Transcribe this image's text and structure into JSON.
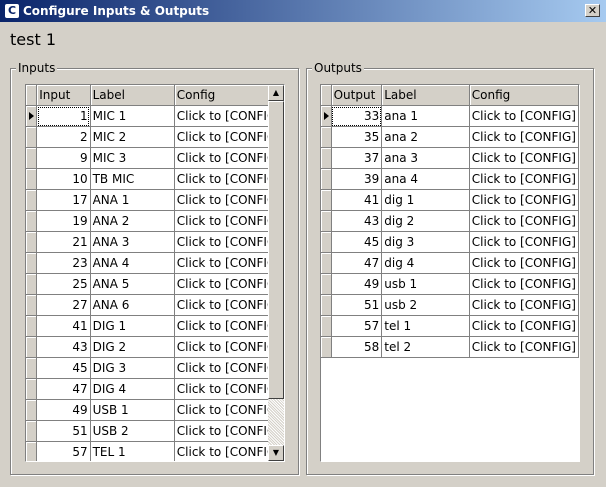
{
  "window": {
    "title": "Configure Inputs & Outputs",
    "app_icon": "C",
    "close": "✕"
  },
  "heading": "test 1",
  "inputs": {
    "group_label": "Inputs",
    "columns": [
      "Input",
      "Label",
      "Config"
    ],
    "rows": [
      {
        "num": "1",
        "label": "MIC 1",
        "config": "Click to [CONFIG]"
      },
      {
        "num": "2",
        "label": "MIC 2",
        "config": "Click to [CONFIG]"
      },
      {
        "num": "9",
        "label": "MIC 3",
        "config": "Click to [CONFIG]"
      },
      {
        "num": "10",
        "label": "TB MIC",
        "config": "Click to [CONFIG]"
      },
      {
        "num": "17",
        "label": "ANA 1",
        "config": "Click to [CONFIG]"
      },
      {
        "num": "19",
        "label": "ANA 2",
        "config": "Click to [CONFIG]"
      },
      {
        "num": "21",
        "label": "ANA 3",
        "config": "Click to [CONFIG]"
      },
      {
        "num": "23",
        "label": "ANA 4",
        "config": "Click to [CONFIG]"
      },
      {
        "num": "25",
        "label": "ANA 5",
        "config": "Click to [CONFIG]"
      },
      {
        "num": "27",
        "label": "ANA 6",
        "config": "Click to [CONFIG]"
      },
      {
        "num": "41",
        "label": "DIG 1",
        "config": "Click to [CONFIG]"
      },
      {
        "num": "43",
        "label": "DIG 2",
        "config": "Click to [CONFIG]"
      },
      {
        "num": "45",
        "label": "DIG 3",
        "config": "Click to [CONFIG]"
      },
      {
        "num": "47",
        "label": "DIG 4",
        "config": "Click to [CONFIG]"
      },
      {
        "num": "49",
        "label": "USB 1",
        "config": "Click to [CONFIG]"
      },
      {
        "num": "51",
        "label": "USB 2",
        "config": "Click to [CONFIG]"
      },
      {
        "num": "57",
        "label": "TEL 1",
        "config": "Click to [CONFIG]"
      }
    ],
    "scroll_up": "▲",
    "scroll_down": "▼"
  },
  "outputs": {
    "group_label": "Outputs",
    "columns": [
      "Output",
      "Label",
      "Config"
    ],
    "rows": [
      {
        "num": "33",
        "label": "ana 1",
        "config": "Click to [CONFIG]"
      },
      {
        "num": "35",
        "label": "ana 2",
        "config": "Click to [CONFIG]"
      },
      {
        "num": "37",
        "label": "ana 3",
        "config": "Click to [CONFIG]"
      },
      {
        "num": "39",
        "label": "ana 4",
        "config": "Click to [CONFIG]"
      },
      {
        "num": "41",
        "label": "dig 1",
        "config": "Click to [CONFIG]"
      },
      {
        "num": "43",
        "label": "dig 2",
        "config": "Click to [CONFIG]"
      },
      {
        "num": "45",
        "label": "dig 3",
        "config": "Click to [CONFIG]"
      },
      {
        "num": "47",
        "label": "dig 4",
        "config": "Click to [CONFIG]"
      },
      {
        "num": "49",
        "label": "usb 1",
        "config": "Click to [CONFIG]"
      },
      {
        "num": "51",
        "label": "usb 2",
        "config": "Click to [CONFIG]"
      },
      {
        "num": "57",
        "label": "tel 1",
        "config": "Click to [CONFIG]"
      },
      {
        "num": "58",
        "label": "tel 2",
        "config": "Click to [CONFIG]"
      }
    ]
  },
  "colors": {
    "titlebar_start": "#0a246a",
    "titlebar_end": "#a6caf0",
    "face": "#d4d0c8"
  }
}
